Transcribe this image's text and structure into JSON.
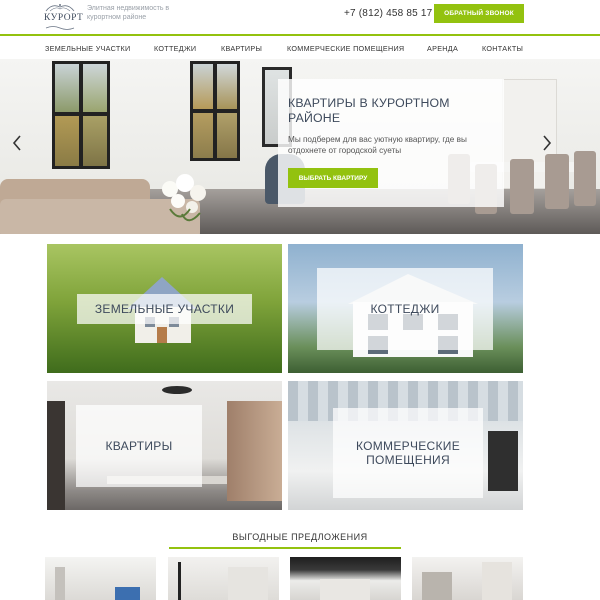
{
  "header": {
    "logo_text": "КУРОРТ",
    "tagline": "Элитная недвижимость в курортном районе",
    "phone": "+7 (812) 458 85 17",
    "callback_label": "ОБРАТНЫЙ ЗВОНОК"
  },
  "nav": {
    "items": [
      {
        "label": "ЗЕМЕЛЬНЫЕ УЧАСТКИ"
      },
      {
        "label": "КОТТЕДЖИ"
      },
      {
        "label": "КВАРТИРЫ"
      },
      {
        "label": "КОММЕРЧЕСКИЕ ПОМЕЩЕНИЯ"
      },
      {
        "label": "АРЕНДА"
      },
      {
        "label": "КОНТАКТЫ"
      }
    ]
  },
  "hero": {
    "title": "КВАРТИРЫ В КУРОРТНОМ РАЙОНЕ",
    "description": "Мы подберем для вас уютную квартиру, где вы отдохнете от городской суеты",
    "button_label": "ВЫБРАТЬ КВАРТИРУ",
    "prev_icon": "chevron-left-icon",
    "next_icon": "chevron-right-icon"
  },
  "tiles": [
    {
      "label": "ЗЕМЕЛЬНЫЕ УЧАСТКИ"
    },
    {
      "label": "КОТТЕДЖИ"
    },
    {
      "label": "КВАРТИРЫ"
    },
    {
      "label": "КОММЕРЧЕСКИЕ ПОМЕЩЕНИЯ"
    }
  ],
  "offers": {
    "title": "ВЫГОДНЫЕ ПРЕДЛОЖЕНИЯ"
  },
  "colors": {
    "accent": "#93c20f",
    "heading": "#3e4a5c"
  }
}
